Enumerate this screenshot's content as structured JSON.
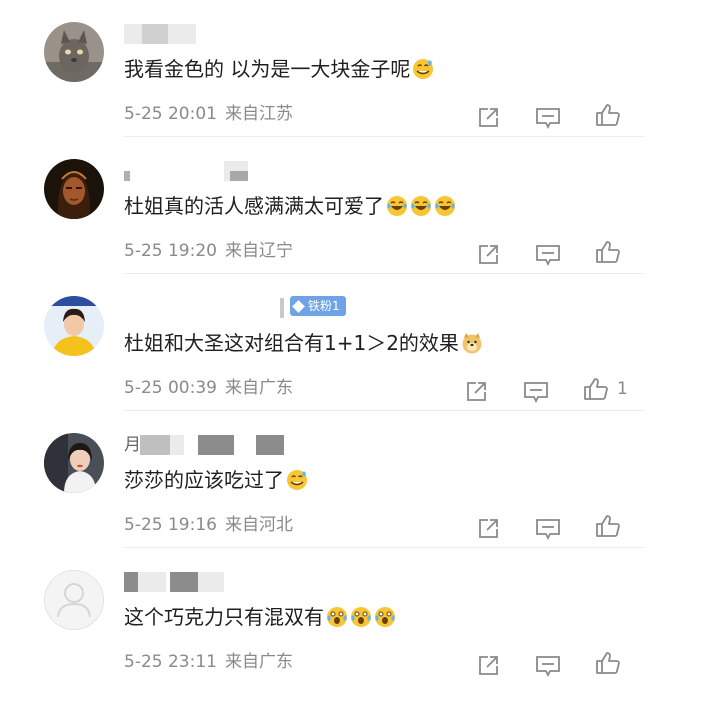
{
  "comments": [
    {
      "content": "我看金色的 以为是一大块金子呢",
      "emojis": [
        "sweat-smile"
      ],
      "time": "5-25 20:01",
      "location": "来自江苏",
      "likes": "",
      "avatar_icon": "cat-photo-avatar"
    },
    {
      "content": "杜姐真的活人感满满太可爱了",
      "emojis": [
        "laugh-cry",
        "laugh-cry",
        "laugh-cry"
      ],
      "time": "5-25 19:20",
      "location": "来自辽宁",
      "likes": "",
      "avatar_icon": "dark-portrait-avatar"
    },
    {
      "content": "杜姐和大圣这对组合有1+1＞2的效果",
      "emojis": [
        "doge"
      ],
      "time": "5-25 00:39",
      "location": "来自广东",
      "likes": "1",
      "badge": "铁粉1",
      "avatar_icon": "yellow-shirt-avatar"
    },
    {
      "content": "莎莎的应该吃过了",
      "emojis": [
        "sweat-smile"
      ],
      "time": "5-25 19:16",
      "location": "来自河北",
      "likes": "",
      "name_fragment": "月",
      "avatar_icon": "selfie-avatar"
    },
    {
      "content": "这个巧克力只有混双有",
      "emojis": [
        "shocked",
        "shocked",
        "shocked"
      ],
      "time": "5-25 23:11",
      "location": "来自广东",
      "likes": "",
      "avatar_icon": "default-user-avatar"
    }
  ],
  "icons": {
    "share": "share-icon",
    "reply": "comment-icon",
    "like": "thumbs-up-icon"
  },
  "colors": {
    "text": "#1f1f1f",
    "meta": "#8a8a8a",
    "badge": "#6fa3e6",
    "divider": "#ececec"
  }
}
